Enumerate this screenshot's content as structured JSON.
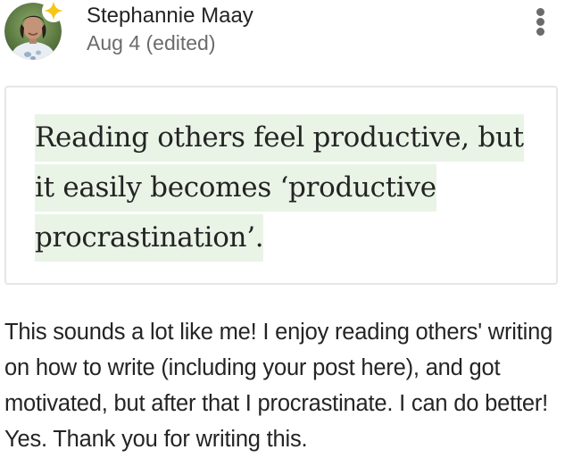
{
  "author": {
    "name": "Stephannie Maay",
    "date": "Aug 4 (edited)",
    "avatar_icon": "user-avatar",
    "badge_icon": "star-sparkle-icon",
    "badge_color": "#f5c518"
  },
  "actions": {
    "more_icon": "more-vertical-icon"
  },
  "quote": {
    "text": "Reading others feel productive, but it easily becomes ‘productive procrastination’.",
    "highlight_color": "#e9f4e6"
  },
  "comment": {
    "text": "This sounds a lot like me! I enjoy reading others' writing on how to write (including your post here), and got motivated, but after that I procrastinate. I can do better! Yes. Thank you for writing this."
  },
  "colors": {
    "primary_text": "#242424",
    "secondary_text": "#6b6b6b",
    "border": "#e6e6e6"
  }
}
